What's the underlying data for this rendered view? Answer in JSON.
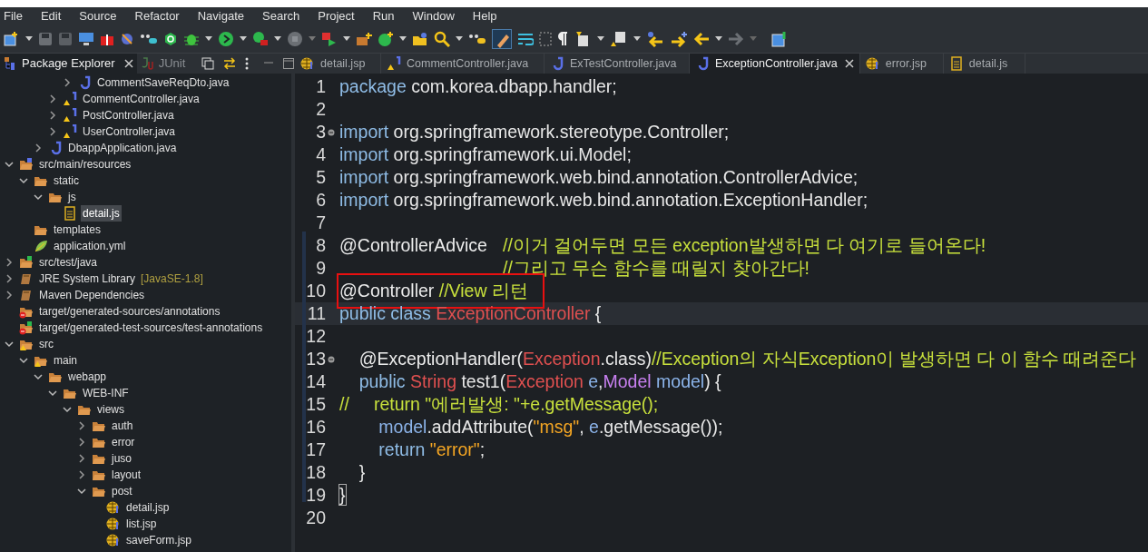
{
  "menu": [
    "File",
    "Edit",
    "Source",
    "Refactor",
    "Navigate",
    "Search",
    "Project",
    "Run",
    "Window",
    "Help"
  ],
  "view_tabs": [
    {
      "label": "Package Explorer",
      "selected": true,
      "kind": "explorer"
    },
    {
      "label": "JUnit",
      "selected": false,
      "kind": "junit"
    }
  ],
  "tree": [
    {
      "children": [
        {
          "children": [
            {
              "children": [
                {
                  "children": [
                    {
                      "label": "CommentSaveReqDto.java",
                      "kind": "java",
                      "expanded": false,
                      "selected": false
                    }
                  ]
                },
                {
                  "label": "CommentController.java",
                  "kind": "java_warning",
                  "expanded": false,
                  "selected": false
                },
                {
                  "label": "PostController.java",
                  "kind": "java_warning",
                  "expanded": false,
                  "selected": false
                },
                {
                  "label": "UserController.java",
                  "kind": "java_warning",
                  "expanded": false,
                  "selected": false
                }
              ]
            },
            {
              "label": "DbappApplication.java",
              "kind": "java",
              "expanded": false,
              "selected": false
            }
          ]
        }
      ]
    },
    {
      "label": "src/main/resources",
      "kind": "source_folder",
      "expanded": true,
      "selected": false,
      "children": [
        {
          "label": "static",
          "kind": "folder",
          "expanded": true,
          "selected": false,
          "children": [
            {
              "label": "js",
              "kind": "folder",
              "expanded": true,
              "selected": false,
              "children": [
                {
                  "label": "detail.js",
                  "kind": "js",
                  "selected": true
                }
              ]
            }
          ]
        },
        {
          "label": "templates",
          "kind": "folder",
          "selected": false
        },
        {
          "label": "application.yml",
          "kind": "yml",
          "selected": false
        }
      ]
    },
    {
      "label": "src/test/java",
      "kind": "test_folder",
      "expanded": false,
      "selected": false
    },
    {
      "label": "JRE System Library",
      "decoration": "[JavaSE-1.8]",
      "kind": "library",
      "expanded": false,
      "selected": false
    },
    {
      "label": "Maven Dependencies",
      "kind": "library",
      "expanded": false,
      "selected": false
    },
    {
      "label": "target/generated-sources/annotations",
      "kind": "error_folder",
      "selected": false
    },
    {
      "label": "target/generated-test-sources/test-annotations",
      "kind": "error_test_folder",
      "selected": false
    },
    {
      "label": "src",
      "kind": "folder_warning",
      "expanded": true,
      "selected": false,
      "children": [
        {
          "label": "main",
          "kind": "folder_warning",
          "expanded": true,
          "selected": false,
          "children": [
            {
              "label": "webapp",
              "kind": "folder",
              "expanded": true,
              "selected": false,
              "children": [
                {
                  "label": "WEB-INF",
                  "kind": "folder",
                  "expanded": true,
                  "selected": false,
                  "children": [
                    {
                      "label": "views",
                      "kind": "folder",
                      "expanded": true,
                      "selected": false,
                      "children": [
                        {
                          "label": "auth",
                          "kind": "folder",
                          "expanded": false,
                          "selected": false
                        },
                        {
                          "label": "error",
                          "kind": "folder",
                          "expanded": false,
                          "selected": false
                        },
                        {
                          "label": "juso",
                          "kind": "folder",
                          "expanded": false,
                          "selected": false
                        },
                        {
                          "label": "layout",
                          "kind": "folder",
                          "expanded": false,
                          "selected": false
                        },
                        {
                          "label": "post",
                          "kind": "folder",
                          "expanded": true,
                          "selected": false,
                          "children": [
                            {
                              "label": "detail.jsp",
                              "kind": "jsp",
                              "selected": false
                            },
                            {
                              "label": "list.jsp",
                              "kind": "jsp",
                              "selected": false
                            },
                            {
                              "label": "saveForm.jsp",
                              "kind": "jsp",
                              "selected": false
                            }
                          ]
                        }
                      ]
                    }
                  ]
                }
              ]
            }
          ]
        }
      ]
    }
  ],
  "editor_tabs": [
    {
      "label": "detail.jsp",
      "kind": "jsp",
      "selected": false
    },
    {
      "label": "CommentController.java",
      "kind": "java_warning",
      "selected": false
    },
    {
      "label": "ExTestController.java",
      "kind": "java",
      "selected": false
    },
    {
      "label": "ExceptionController.java",
      "kind": "java",
      "selected": true
    },
    {
      "label": "error.jsp",
      "kind": "jsp",
      "selected": false
    },
    {
      "label": "detail.js",
      "kind": "js",
      "selected": false
    }
  ],
  "code_lines": [
    {
      "number": "1",
      "tokens": [
        {
          "kind": "keyword",
          "text": "package"
        },
        {
          "kind": "plain",
          "text": " com.korea.dbapp.handler;"
        }
      ]
    },
    {
      "number": "2"
    },
    {
      "number": "3",
      "foldable": true,
      "tokens": [
        {
          "kind": "keyword",
          "text": "import"
        },
        {
          "kind": "plain",
          "text": " org.springframework.stereotype.Controller;"
        }
      ]
    },
    {
      "number": "4",
      "tokens": [
        {
          "kind": "keyword",
          "text": "import"
        },
        {
          "kind": "plain",
          "text": " org.springframework.ui.Model;"
        }
      ]
    },
    {
      "number": "5",
      "tokens": [
        {
          "kind": "keyword",
          "text": "import"
        },
        {
          "kind": "plain",
          "text": " org.springframework.web.bind.annotation.ControllerAdvice;"
        }
      ]
    },
    {
      "number": "6",
      "tokens": [
        {
          "kind": "keyword",
          "text": "import"
        },
        {
          "kind": "plain",
          "text": " org.springframework.web.bind.annotation.ExceptionHandler;"
        }
      ]
    },
    {
      "number": "7"
    },
    {
      "number": "8",
      "tokens": [
        {
          "kind": "annotation",
          "text": "@ControllerAdvice\t"
        },
        {
          "kind": "comment",
          "text": "//이거 걸어두면 모든 exception발생하면 다 여기로 들어온다!"
        }
      ]
    },
    {
      "number": "9",
      "tokens": [
        {
          "kind": "comment",
          "text": "\t//그리고 무슨 함수를 때릴지 찾아간다!"
        }
      ]
    },
    {
      "number": "10",
      "highlighted": true,
      "tokens": [
        {
          "kind": "annotation",
          "text": "@Controller "
        },
        {
          "kind": "comment",
          "text": "//View 리턴"
        }
      ]
    },
    {
      "number": "11",
      "current": true,
      "tokens": [
        {
          "kind": "keyword",
          "text": "public class "
        },
        {
          "kind": "type",
          "text": "ExceptionController"
        },
        {
          "kind": "plain",
          "text": " {"
        }
      ]
    },
    {
      "number": "12"
    },
    {
      "number": "13",
      "foldable": true,
      "tokens": [
        {
          "kind": "annotation",
          "text": "    @ExceptionHandler("
        },
        {
          "kind": "type",
          "text": "Exception"
        },
        {
          "kind": "plain",
          "text": ".class)"
        },
        {
          "kind": "comment",
          "text": "//Exception의 자식Exception이 발생하면 다 이 함수 때려준다"
        }
      ]
    },
    {
      "number": "14",
      "tokens": [
        {
          "kind": "keyword",
          "text": "    public "
        },
        {
          "kind": "type",
          "text": "String"
        },
        {
          "kind": "plain",
          "text": " test1("
        },
        {
          "kind": "type",
          "text": "Exception"
        },
        {
          "kind": "variable",
          "text": " e"
        },
        {
          "kind": "plain",
          "text": ","
        },
        {
          "kind": "interface",
          "text": "Model"
        },
        {
          "kind": "variable",
          "text": " model"
        },
        {
          "kind": "plain",
          "text": ") {"
        }
      ]
    },
    {
      "number": "15",
      "tokens": [
        {
          "kind": "comment",
          "text": "//     return \"에러발생: \"+e.getMessage();"
        }
      ]
    },
    {
      "number": "16",
      "tokens": [
        {
          "kind": "variable",
          "text": "        model"
        },
        {
          "kind": "plain",
          "text": ".addAttribute("
        },
        {
          "kind": "string",
          "text": "\"msg\""
        },
        {
          "kind": "plain",
          "text": ", "
        },
        {
          "kind": "variable",
          "text": "e"
        },
        {
          "kind": "plain",
          "text": ".getMessage());"
        }
      ]
    },
    {
      "number": "17",
      "tokens": [
        {
          "kind": "keyword",
          "text": "        return "
        },
        {
          "kind": "string",
          "text": "\"error\""
        },
        {
          "kind": "plain",
          "text": ";"
        }
      ]
    },
    {
      "number": "18",
      "tokens": [
        {
          "kind": "plain",
          "text": "    }"
        }
      ]
    },
    {
      "number": "19",
      "tokens": [
        {
          "kind": "bracket_match",
          "text": "}"
        }
      ]
    },
    {
      "number": "20"
    }
  ]
}
